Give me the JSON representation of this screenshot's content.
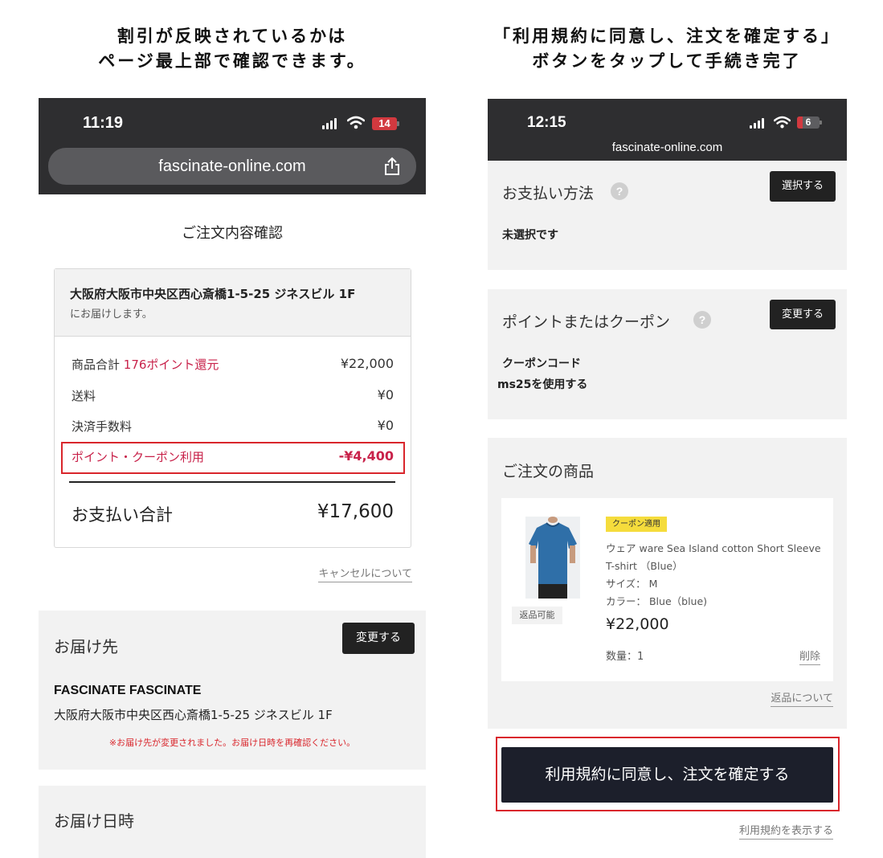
{
  "captions": {
    "left_line1": "割引が反映されているかは",
    "left_line2": "ページ最上部で確認できます。",
    "right_line1": "「利用規約に同意し、注文を確定する」",
    "right_line2": "ボタンをタップして手続き完了"
  },
  "left": {
    "status": {
      "time": "11:19",
      "battery": "14"
    },
    "url": "fascinate-online.com",
    "page_title": "ご注文内容確認",
    "address": {
      "line": "大阪府大阪市中央区西心斎橋1-5-25 ジネスビル 1F",
      "note": "にお届けします。"
    },
    "summary": {
      "subtotal_label": "商品合計",
      "points_return": "176ポイント還元",
      "subtotal_value": "¥22,000",
      "shipping_label": "送料",
      "shipping_value": "¥0",
      "fee_label": "決済手数料",
      "fee_value": "¥0",
      "discount_label": "ポイント・クーポン利用",
      "discount_value": "-¥4,400",
      "total_label": "お支払い合計",
      "total_value": "¥17,600"
    },
    "cancel_link": "キャンセルについて",
    "delivery": {
      "heading": "お届け先",
      "change_button": "変更する",
      "name": "FASCINATE FASCINATE",
      "address": "大阪府大阪市中央区西心斎橋1-5-25 ジネスビル 1F",
      "warning": "※お届け先が変更されました。お届け日時を再確認ください。"
    },
    "delivery_time_heading": "お届け日時"
  },
  "right": {
    "status": {
      "time": "12:15",
      "battery": "6"
    },
    "url": "fascinate-online.com",
    "payment": {
      "heading": "お支払い方法",
      "help": "?",
      "button": "選択する",
      "value": "未選択です"
    },
    "coupon": {
      "heading": "ポイントまたはクーポン",
      "help": "?",
      "button": "変更する",
      "code_label": "クーポンコード",
      "code_value": "ms25を使用する"
    },
    "order_items": {
      "heading": "ご注文の商品",
      "badge": "クーポン適用",
      "name_line1": "ウェア ware Sea Island cotton Short Sleeve",
      "name_line2": "T-shirt （Blue）",
      "size": "サイズ： M",
      "color": "カラー： Blue（blue)",
      "price": "¥22,000",
      "returnable": "返品可能",
      "quantity": "数量：1",
      "delete": "削除"
    },
    "return_link": "返品について",
    "confirm_button": "利用規約に同意し、注文を確定する",
    "terms_link": "利用規約を表示する"
  },
  "colors": {
    "accent_red": "#c8224a",
    "highlight_border": "#d9262c",
    "dark": "#222222",
    "coupon_badge": "#f5dc3c",
    "shirt_blue": "#2f6fa8"
  },
  "icons": [
    "signal-icon",
    "wifi-icon",
    "battery-icon",
    "share-icon",
    "help-icon",
    "tshirt-product-image"
  ]
}
